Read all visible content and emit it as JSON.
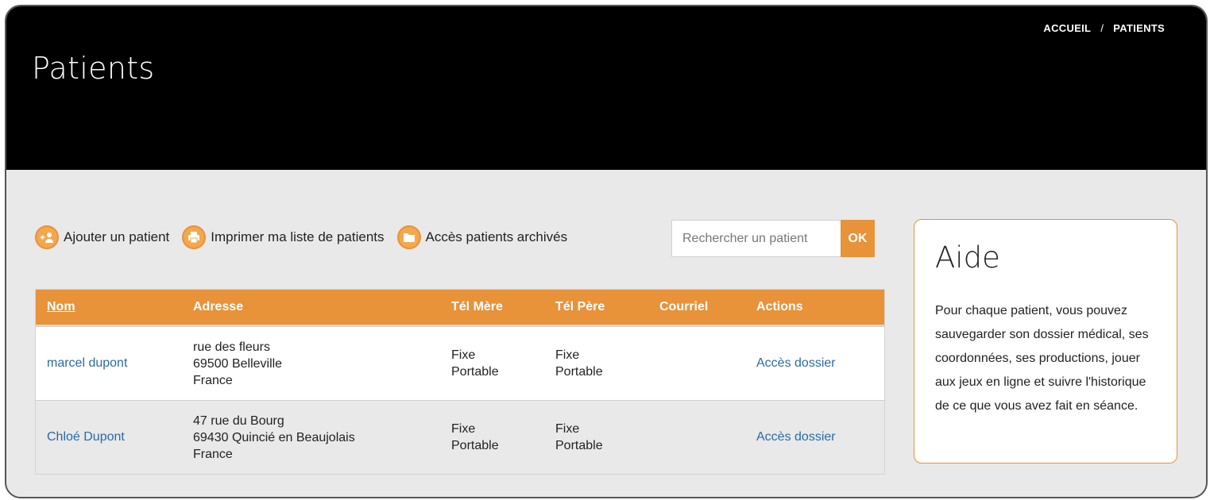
{
  "header": {
    "title": "Patients",
    "breadcrumb": [
      "ACCUEIL",
      "PATIENTS"
    ],
    "breadcrumb_separator": "/"
  },
  "toolbar": {
    "add_label": "Ajouter un patient",
    "print_label": "Imprimer ma liste de patients",
    "archive_label": "Accès patients archivés"
  },
  "search": {
    "placeholder": "Rechercher un patient",
    "submit_label": "OK"
  },
  "table": {
    "columns": [
      "Nom",
      "Adresse",
      "Tél Mère",
      "Tél Père",
      "Courriel",
      "Actions"
    ],
    "rows": [
      {
        "name": "marcel dupont",
        "address": [
          "rue des fleurs",
          "69500 Belleville",
          "France"
        ],
        "tel_mere": [
          "Fixe",
          "Portable"
        ],
        "tel_pere": [
          "Fixe",
          "Portable"
        ],
        "courriel": "",
        "action": "Accès dossier"
      },
      {
        "name": "Chloé Dupont",
        "address": [
          "47 rue du Bourg",
          "69430 Quincié en Beaujolais",
          "France"
        ],
        "tel_mere": [
          "Fixe",
          "Portable"
        ],
        "tel_pere": [
          "Fixe",
          "Portable"
        ],
        "courriel": "",
        "action": "Accès dossier"
      }
    ]
  },
  "help": {
    "title": "Aide",
    "text": "Pour chaque patient, vous pouvez sauvegarder son dossier médical, ses coordonnées, ses productions, jouer aux jeux en ligne et suivre l'historique de ce que vous avez fait en séance."
  },
  "colors": {
    "accent": "#e8923a",
    "header_bg": "#000000",
    "content_bg": "#e8e9e8",
    "link": "#2b6aa8"
  }
}
